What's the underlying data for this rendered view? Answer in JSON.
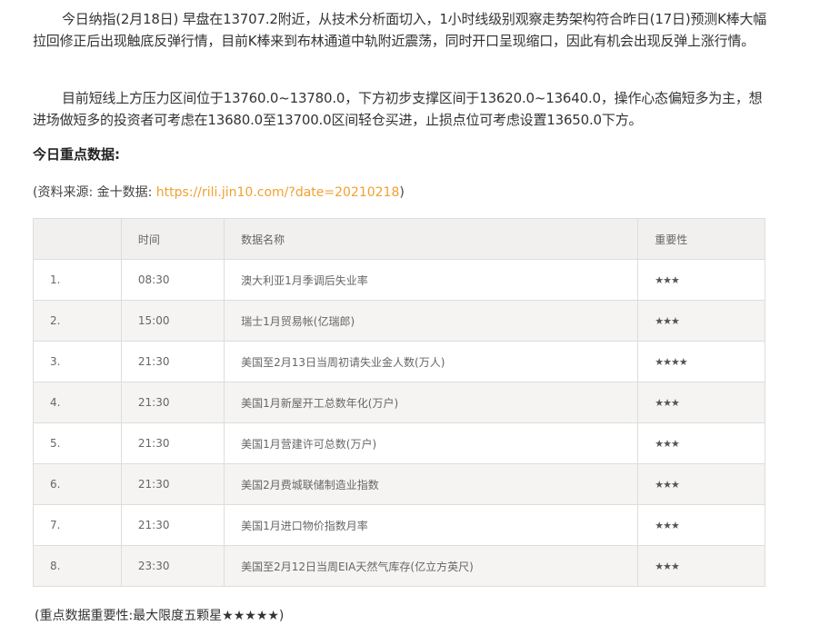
{
  "article": {
    "paragraph1": "今日纳指(2月18日) 早盘在13707.2附近，从技术分析面切入，1小时线级别观察走势架构符合昨日(17日)预测K棒大幅拉回修正后出现触底反弹行情，目前K棒来到布林通道中轨附近震荡，同时开口呈现缩口，因此有机会出现反弹上涨行情。",
    "paragraph2": "目前短线上方压力区间位于13760.0~13780.0，下方初步支撑区间于13620.0~13640.0，操作心态偏短多为主，想进场做短多的投资者可考虑在13680.0至13700.0区间轻仓买进，止损点位可考虑设置13650.0下方。",
    "section_title": "今日重点数据:",
    "source_prefix": "(资料来源: 金十数据: ",
    "source_link": "https://rili.jin10.com/?date=20210218",
    "source_suffix": ")",
    "footnote": "(重点数据重要性:最大限度五颗星★★★★★)"
  },
  "table": {
    "headers": {
      "index": "",
      "time": "时间",
      "name": "数据名称",
      "importance": "重要性"
    },
    "rows": [
      {
        "index": "1.",
        "time": "08:30",
        "name": "澳大利亚1月季调后失业率",
        "importance": "★★★"
      },
      {
        "index": "2.",
        "time": "15:00",
        "name": "瑞士1月贸易帐(亿瑞郎)",
        "importance": "★★★"
      },
      {
        "index": "3.",
        "time": "21:30",
        "name": "美国至2月13日当周初请失业金人数(万人)",
        "importance": "★★★★"
      },
      {
        "index": "4.",
        "time": "21:30",
        "name": "美国1月新屋开工总数年化(万户)",
        "importance": "★★★"
      },
      {
        "index": "5.",
        "time": "21:30",
        "name": "美国1月营建许可总数(万户)",
        "importance": "★★★"
      },
      {
        "index": "6.",
        "time": "21:30",
        "name": "美国2月费城联储制造业指数",
        "importance": "★★★"
      },
      {
        "index": "7.",
        "time": "21:30",
        "name": "美国1月进口物价指数月率",
        "importance": "★★★"
      },
      {
        "index": "8.",
        "time": "23:30",
        "name": "美国至2月12日当周EIA天然气库存(亿立方英尺)",
        "importance": "★★★"
      }
    ]
  },
  "colors": {
    "link": "#f0a030",
    "header_bg": "#f2f0ee",
    "stripe_bg": "#f5f4f2",
    "border": "#dddddd"
  }
}
